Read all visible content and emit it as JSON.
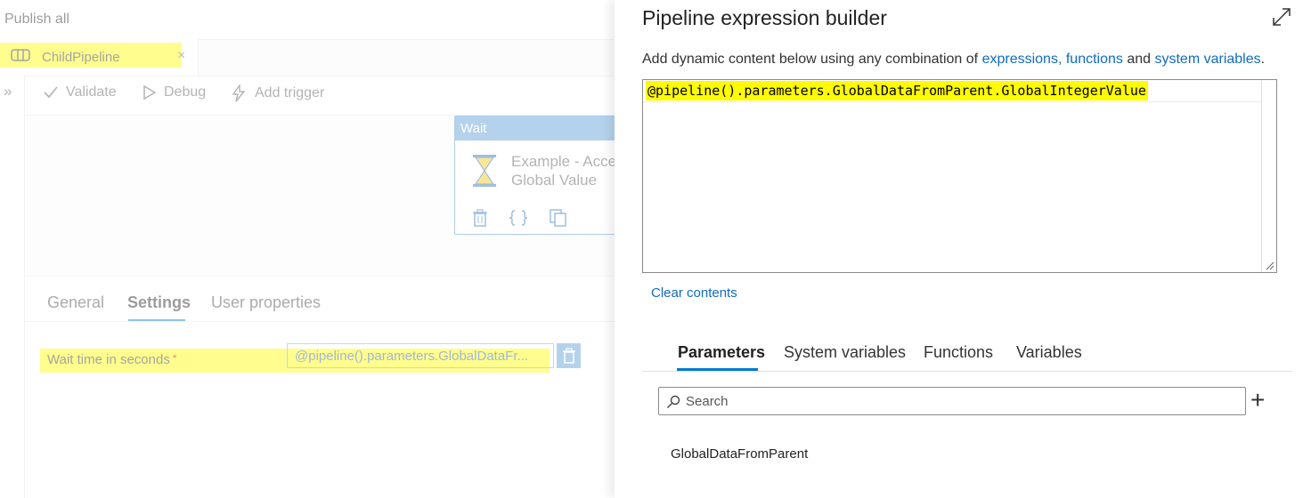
{
  "left": {
    "publish_label": "Publish all",
    "tab": {
      "label": "ChildPipeline",
      "close": "×"
    },
    "collapse_glyph": "»",
    "toolbar": {
      "validate": "Validate",
      "debug": "Debug",
      "add_trigger": "Add trigger"
    },
    "wait_activity": {
      "header": "Wait",
      "line1": "Example - Acce",
      "line2": "Global Value"
    },
    "props_tabs": [
      "General",
      "Settings",
      "User properties"
    ],
    "active_props_tab": "Settings",
    "wait_time": {
      "label": "Wait time in seconds",
      "required": "*",
      "value": "@pipeline().parameters.GlobalDataFr..."
    }
  },
  "builder": {
    "title": "Pipeline expression builder",
    "desc_prefix": "Add dynamic content below using any combination of ",
    "link_expressions": "expressions,",
    "link_functions": "functions",
    "desc_and": " and ",
    "link_system_variables": "system variables",
    "desc_suffix": ".",
    "expression": "@pipeline().parameters.GlobalDataFromParent.GlobalIntegerValue",
    "clear_label": "Clear contents",
    "tabs": [
      "Parameters",
      "System variables",
      "Functions",
      "Variables"
    ],
    "active_tab": "Parameters",
    "search_placeholder": "Search",
    "add_glyph": "+",
    "parameters": [
      "GlobalDataFromParent"
    ]
  },
  "colors": {
    "highlight": "#fffb00",
    "accent": "#0078d4",
    "link": "#0f6cbd"
  }
}
